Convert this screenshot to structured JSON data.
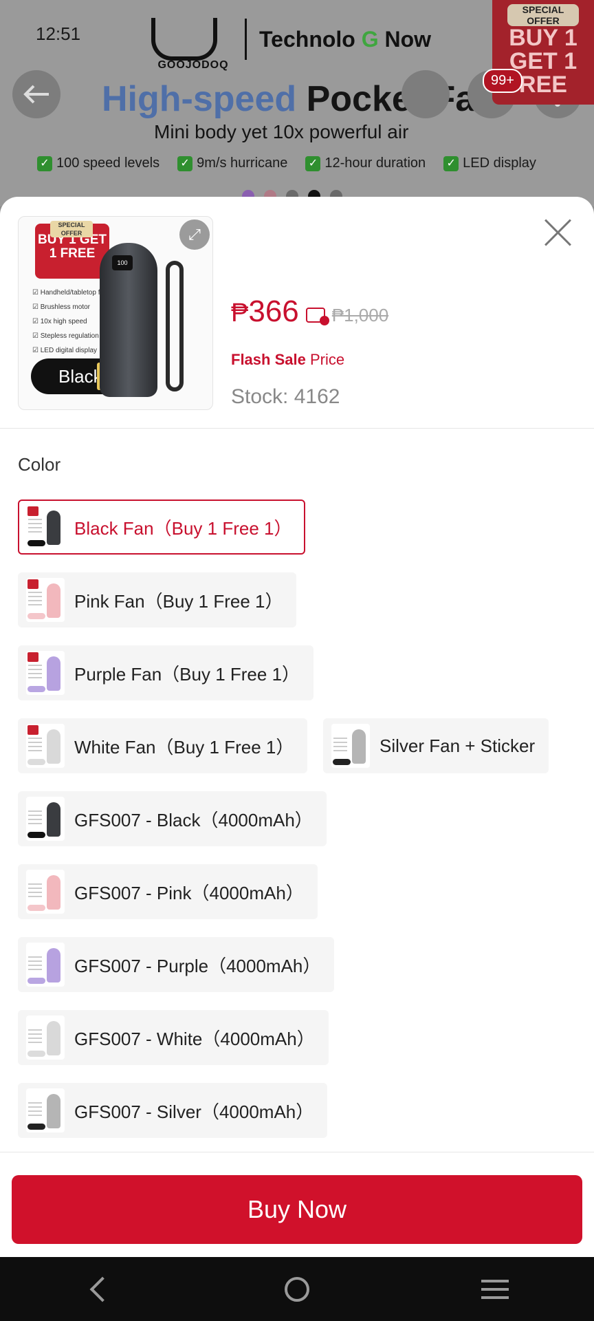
{
  "status_bar": {
    "time": "12:51"
  },
  "background_page": {
    "brand_logo": "GOOJODOQ",
    "store_name_prefix": "Technolo ",
    "store_name_g": "G",
    "store_name_suffix": " Now",
    "cart_badge": "99+",
    "offer_small": "SPECIAL OFFER",
    "offer_big_1": "BUY 1",
    "offer_big_2": "GET 1",
    "offer_big_3": "REE",
    "headline_colored": "High-speed",
    "headline_rest": " Pocket Fan",
    "subheadline": "Mini body yet 10x powerful air",
    "features": [
      "100 speed levels",
      "9m/s hurricane",
      "12-hour duration",
      "LED display"
    ]
  },
  "sheet": {
    "thumbnail": {
      "promo_tag": "SPECIAL OFFER",
      "promo_text": "BUY 1 GET 1 FREE",
      "feature_list": [
        "Handheld/tabletop fan",
        "Brushless motor",
        "10x high speed",
        "Stepless regulation",
        "LED digital display"
      ],
      "color_pill": "Black",
      "screen_text": "100"
    },
    "price_currency": "₱",
    "price_value": "366",
    "original_price": "₱1,000",
    "flash_bold": "Flash Sale",
    "flash_rest": " Price",
    "stock": "Stock: 4162",
    "color_label": "Color",
    "options": [
      {
        "label": "Black Fan（Buy 1 Free 1）",
        "selected": true,
        "fan_color": "#3a3c40",
        "pill_color": "#111111",
        "promo": true
      },
      {
        "label": "Pink Fan（Buy 1 Free 1）",
        "selected": false,
        "fan_color": "#f2b8bd",
        "pill_color": "#f4c6ca",
        "promo": true
      },
      {
        "label": "Purple Fan（Buy 1 Free 1）",
        "selected": false,
        "fan_color": "#b7a2e0",
        "pill_color": "#b9a6e2",
        "promo": true
      },
      {
        "label": "White Fan（Buy 1 Free 1）",
        "selected": false,
        "fan_color": "#d9d9d9",
        "pill_color": "#dcdcdc",
        "promo": true
      },
      {
        "label": "Silver Fan + Sticker",
        "selected": false,
        "fan_color": "#b5b5b5",
        "pill_color": "#222222",
        "promo": false
      },
      {
        "label": "GFS007 - Black（4000mAh）",
        "selected": false,
        "fan_color": "#3a3c40",
        "pill_color": "#111111",
        "promo": false
      },
      {
        "label": "GFS007 - Pink（4000mAh）",
        "selected": false,
        "fan_color": "#f2b8bd",
        "pill_color": "#f4c6ca",
        "promo": false
      },
      {
        "label": "GFS007 - Purple（4000mAh）",
        "selected": false,
        "fan_color": "#b7a2e0",
        "pill_color": "#b9a6e2",
        "promo": false
      },
      {
        "label": "GFS007 - White（4000mAh）",
        "selected": false,
        "fan_color": "#d9d9d9",
        "pill_color": "#dcdcdc",
        "promo": false
      },
      {
        "label": "GFS007 - Silver（4000mAh）",
        "selected": false,
        "fan_color": "#b5b5b5",
        "pill_color": "#222222",
        "promo": false
      }
    ],
    "buy_button": "Buy Now"
  },
  "nav_bar": {
    "icons": [
      "back-icon",
      "home-icon",
      "recents-icon"
    ]
  },
  "colors": {
    "accent": "#c8102e",
    "buy_button": "#d0112b"
  }
}
